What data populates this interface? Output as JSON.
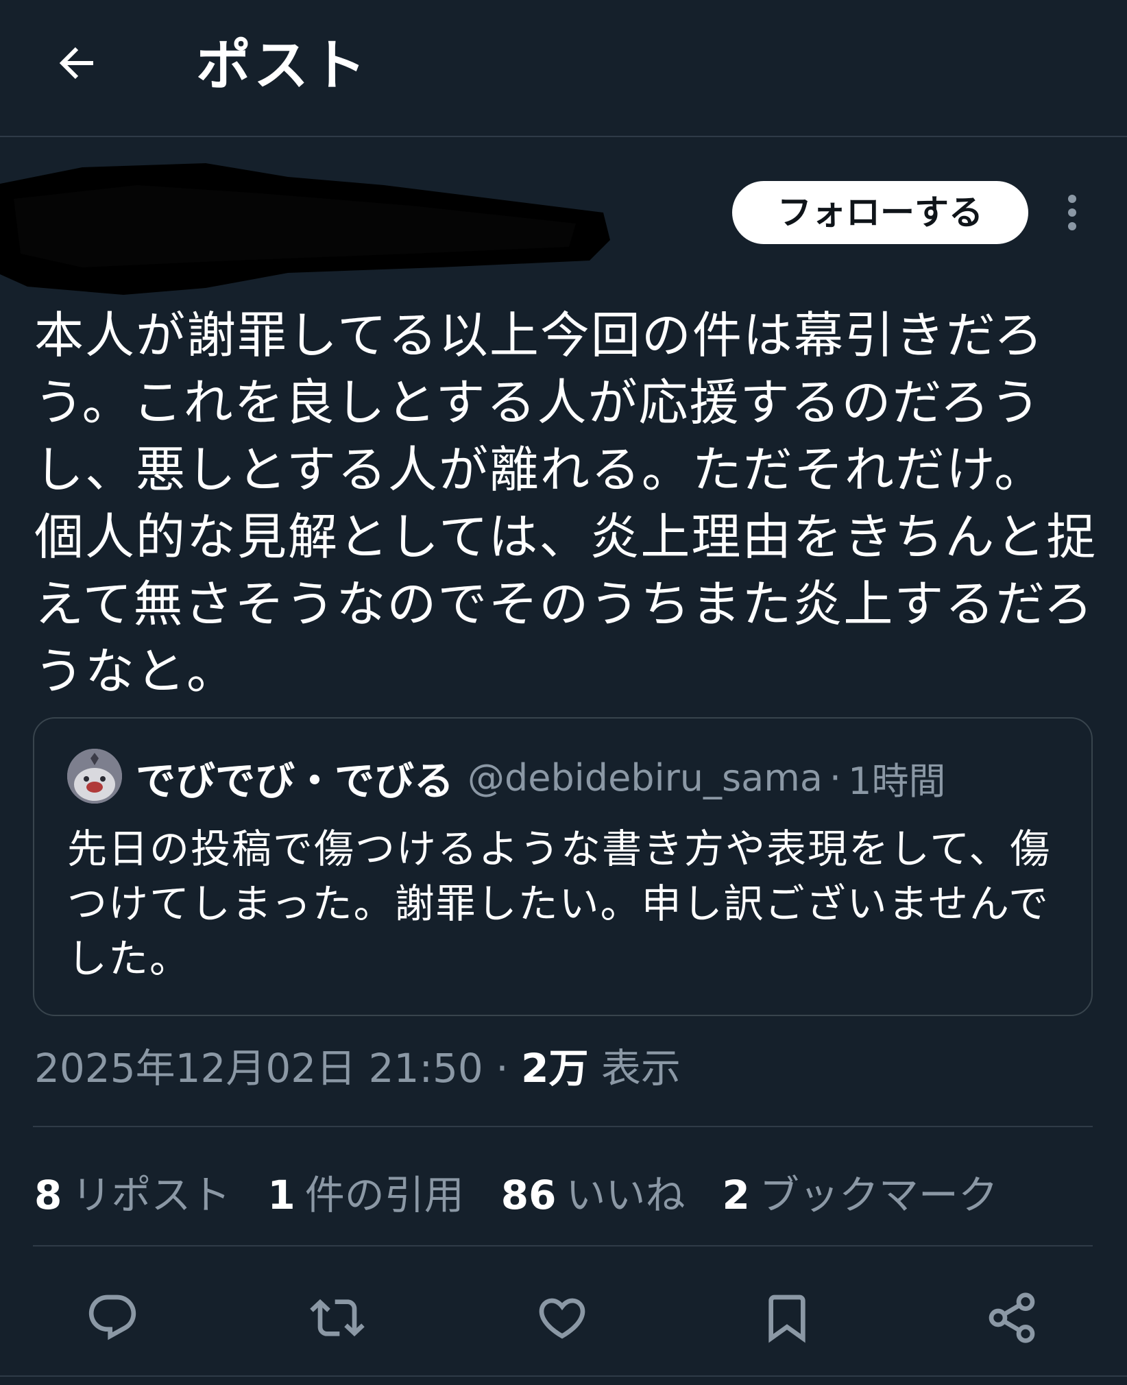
{
  "header": {
    "back_icon": "arrow-left-icon",
    "title": "ポスト"
  },
  "author": {
    "redacted": true,
    "follow_label": "フォローする",
    "more_icon": "more-vertical-icon"
  },
  "post": {
    "text": "本人が謝罪してる以上今回の件は幕引きだろう。これを良しとする人が応援するのだろうし、悪しとする人が離れる。ただそれだけ。\n個人的な見解としては、炎上理由をきちんと捉えて無さそうなのでそのうちまた炎上するだろうなと。"
  },
  "quote": {
    "name": "でびでび・でびる",
    "handle": "@debidebiru_sama",
    "separator": "·",
    "time": "1時間",
    "text": "先日の投稿で傷つけるような書き方や表現をして、傷つけてしまった。謝罪したい。申し訳ございませんでした。"
  },
  "meta": {
    "timestamp": "2025年12月02日 21:50",
    "separator": "·",
    "views_count": "2万",
    "views_label": "表示"
  },
  "stats": [
    {
      "num": "8",
      "label": "リポスト"
    },
    {
      "num": "1",
      "label": "件の引用"
    },
    {
      "num": "86",
      "label": "いいね"
    },
    {
      "num": "2",
      "label": "ブックマーク"
    }
  ],
  "actions": {
    "reply_icon": "reply-icon",
    "repost_icon": "repost-icon",
    "like_icon": "heart-icon",
    "bookmark_icon": "bookmark-icon",
    "share_icon": "share-icon"
  },
  "colors": {
    "background": "#15202b",
    "text_primary": "#ffffff",
    "text_secondary": "#8b98a5",
    "border": "#2f3b47",
    "button_bg": "#ffffff",
    "button_text": "#0f1419"
  }
}
